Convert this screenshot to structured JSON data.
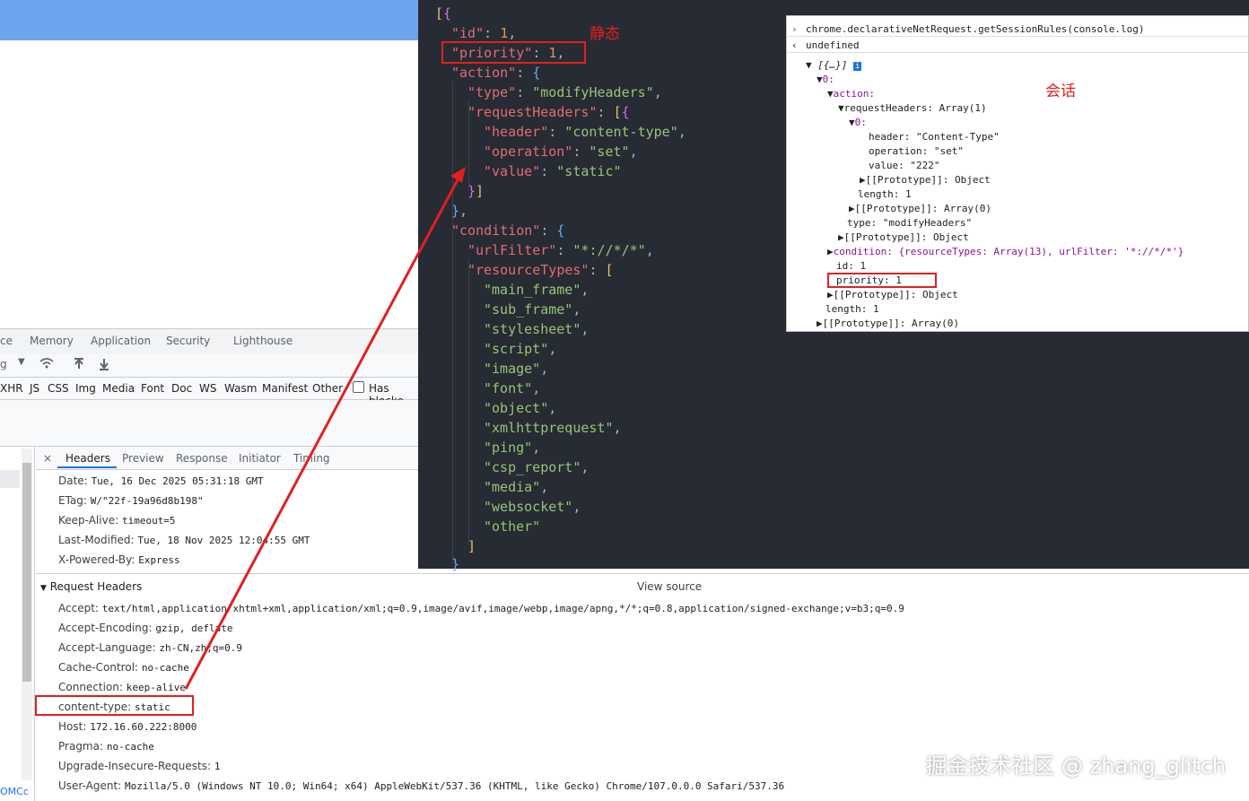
{
  "devtools": {
    "tabs": [
      "ce",
      "Memory",
      "Application",
      "Security",
      "Lighthouse"
    ],
    "filters": [
      "XHR",
      "JS",
      "CSS",
      "Img",
      "Media",
      "Font",
      "Doc",
      "WS",
      "Wasm",
      "Manifest",
      "Other"
    ],
    "has_blocked": "Has blocke",
    "detail_tabs": [
      "Headers",
      "Preview",
      "Response",
      "Initiator",
      "Timing"
    ],
    "close": "×",
    "response_headers": [
      {
        "k": "Date:",
        "v": "Tue, 16 Dec 2025 05:31:18 GMT"
      },
      {
        "k": "ETag:",
        "v": "W/\"22f-19a96d8b198\""
      },
      {
        "k": "Keep-Alive:",
        "v": "timeout=5"
      },
      {
        "k": "Last-Modified:",
        "v": "Tue, 18 Nov 2025 12:04:55 GMT"
      },
      {
        "k": "X-Powered-By:",
        "v": "Express"
      }
    ],
    "request_section": "Request Headers",
    "view_source": "View source",
    "request_headers": [
      {
        "k": "Accept:",
        "v": "text/html,application/xhtml+xml,application/xml;q=0.9,image/avif,image/webp,image/apng,*/*;q=0.8,application/signed-exchange;v=b3;q=0.9"
      },
      {
        "k": "Accept-Encoding:",
        "v": "gzip, deflate"
      },
      {
        "k": "Accept-Language:",
        "v": "zh-CN,zh;q=0.9"
      },
      {
        "k": "Cache-Control:",
        "v": "no-cache"
      },
      {
        "k": "Connection:",
        "v": "keep-alive"
      },
      {
        "k": "content-type:",
        "v": "static"
      },
      {
        "k": "Host:",
        "v": "172.16.60.222:8000"
      },
      {
        "k": "Pragma:",
        "v": "no-cache"
      },
      {
        "k": "Upgrade-Insecure-Requests:",
        "v": "1"
      },
      {
        "k": "User-Agent:",
        "v": "Mozilla/5.0 (Windows NT 10.0; Win64; x64) AppleWebKit/537.36 (KHTML, like Gecko) Chrome/107.0.0.0 Safari/537.36"
      }
    ],
    "left_stub": "OMCc"
  },
  "annotations": {
    "static_label": "静态",
    "session_label": "会话"
  },
  "console": {
    "command": "chrome.declarativeNetRequest.getSessionRules(console.log)",
    "result": "undefined",
    "lines": [
      "[{…}]",
      "0:",
      "action:",
      "requestHeaders: Array(1)",
      "0:",
      "header: \"Content-Type\"",
      "operation: \"set\"",
      "value: \"222\"",
      "[[Prototype]]: Object",
      "length: 1",
      "[[Prototype]]: Array(0)",
      "type: \"modifyHeaders\"",
      "[[Prototype]]: Object",
      "condition: {resourceTypes: Array(13), urlFilter: '*://*/*'}",
      "id: 1",
      "priority: 1",
      "[[Prototype]]: Object",
      "length: 1",
      "[[Prototype]]: Array(0)"
    ]
  },
  "watermark": "掘金技术社区 @ zhang_glitch",
  "colors": {
    "editor_bg": "#272b33",
    "key": "#e06c75",
    "string": "#98c379",
    "number": "#d19a66",
    "annotation": "#e02020"
  }
}
